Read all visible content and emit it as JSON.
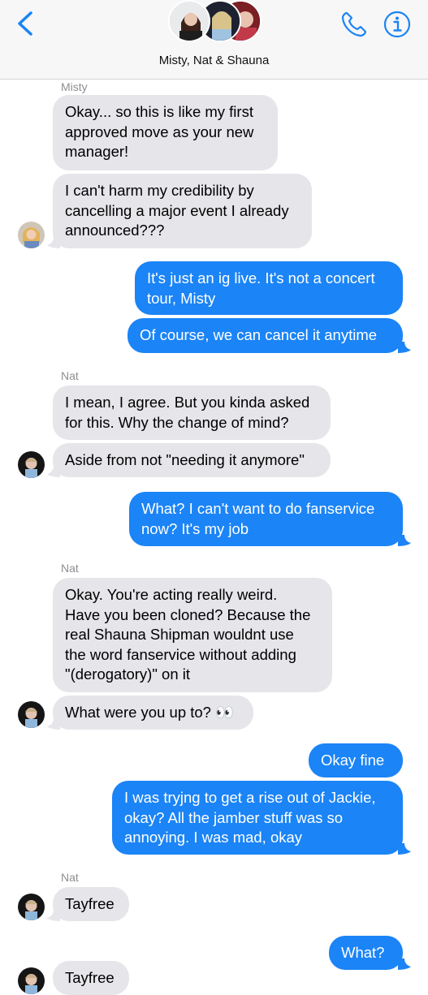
{
  "header": {
    "title": "Misty, Nat & Shauna",
    "back_icon": "chevron-left-icon",
    "call_icon": "phone-icon",
    "info_icon": "info-icon",
    "accent": "#1b84f6"
  },
  "messages": {
    "sender_misty": "Misty",
    "m1": "Okay... so this is like my first\napproved move as your new\nmanager!",
    "m2": "I can't harm my credibility by\ncancelling a major event I already\nannounced???",
    "m3": "It's just an ig live. It's not a concert\ntour, Misty",
    "m4": "Of course, we can cancel it anytime",
    "sender_nat_1": "Nat",
    "m5": "I mean, I agree. But you kinda asked\nfor this. Why the change of mind?",
    "m6": "Aside from not \"needing it anymore\"",
    "m7": "What? I can't want to do fanservice\nnow? It's my job",
    "sender_nat_2": "Nat",
    "m8": "Okay. You're acting really weird.\nHave you been cloned? Because the\nreal Shauna Shipman wouldnt use\nthe word fanservice without adding\n\"(derogatory)\" on it",
    "m9": "What were you up to? 👀",
    "m10": "Okay fine",
    "m11": "I was tryjng to get a rise out of Jackie,\nokay? All the jamber stuff was so\nannoying. I was mad, okay",
    "sender_nat_3": "Nat",
    "m12": "Tayfree",
    "m13": "What?",
    "m14": "Tayfree"
  },
  "colors": {
    "incoming": "#e5e5ea",
    "outgoing": "#1b84f6",
    "header_bg": "#f7f7f7"
  }
}
